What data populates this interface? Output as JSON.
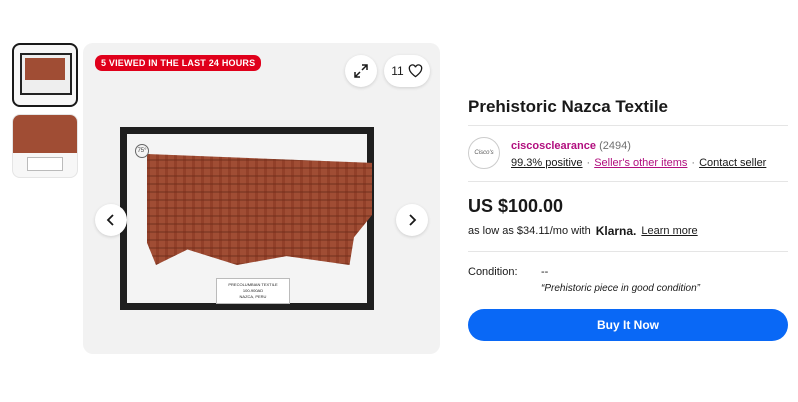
{
  "gallery": {
    "viewed_badge": "5 VIEWED IN THE LAST 24 HOURS",
    "watch_count": "11",
    "seal_text": "75°",
    "card_lines": [
      "PRECOLUMBIAN TEXTILE",
      "100-900AD",
      "NAZCA, PERU"
    ]
  },
  "listing": {
    "title": "Prehistoric Nazca Textile",
    "price": "US $100.00",
    "installment_text": "as low as $34.11/mo with",
    "installment_brand": "Klarna.",
    "learn_more": "Learn more",
    "buy_label": "Buy It Now"
  },
  "seller": {
    "name": "ciscosclearance",
    "feedback_count": "(2494)",
    "positive": "99.3% positive",
    "other_items": "Seller's other items",
    "contact": "Contact seller",
    "logo_text": "Cisco's"
  },
  "condition": {
    "label": "Condition:",
    "value": "--",
    "note_open": "“",
    "note": "Prehistoric piece in good condition",
    "note_close": "”"
  },
  "colors": {
    "accent_blue": "#0968f6",
    "seller_pink": "#b10e7e",
    "badge_red": "#e0001b"
  },
  "icons": [
    "expand-icon",
    "heart-icon",
    "chevron-left-icon",
    "chevron-right-icon"
  ]
}
